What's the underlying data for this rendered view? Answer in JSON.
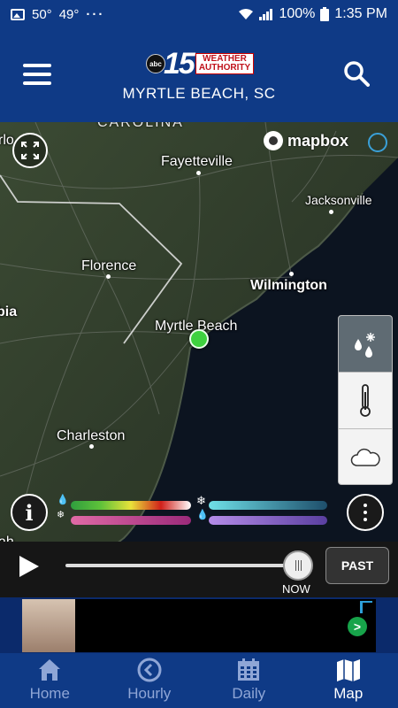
{
  "status_bar": {
    "temp_current": "50°",
    "temp_low": "49°",
    "dots": "···",
    "battery": "100%",
    "time": "1:35 PM"
  },
  "header": {
    "logo_network": "abc",
    "logo_number": "15",
    "logo_badge_line1": "WEATHER",
    "logo_badge_line2": "AUTHORITY",
    "location": "MYRTLE BEACH, SC"
  },
  "map": {
    "attribution": "mapbox",
    "state_label": "CAROLINA",
    "cities": {
      "fayetteville": "Fayetteville",
      "jacksonville": "Jacksonville",
      "florence": "Florence",
      "wilmington": "Wilmington",
      "myrtle_beach": "Myrtle Beach",
      "charleston": "Charleston",
      "partial_left_top": "rlo",
      "partial_left_mid": "bia",
      "partial_left_bottom": "ah"
    },
    "layers": [
      {
        "name": "precipitation",
        "icon": "rain-snow-icon",
        "active": true
      },
      {
        "name": "temperature",
        "icon": "thermometer-icon",
        "active": false
      },
      {
        "name": "clouds",
        "icon": "cloud-icon",
        "active": false
      }
    ],
    "legend": {
      "rain_colors": [
        "#3bb24a",
        "#e8e23a",
        "#d0201a",
        "#ffffff"
      ],
      "snow_colors": [
        "#6fe0e8",
        "#1e4e6b"
      ],
      "mix_colors": [
        "#e06aa6",
        "#9b2a7a"
      ],
      "ice_colors": [
        "#b58ce8",
        "#5a3fa0"
      ]
    }
  },
  "timeline": {
    "now_label": "NOW",
    "past_label": "PAST",
    "progress": 0.94
  },
  "ad": {
    "go_symbol": ">"
  },
  "bottom_nav": [
    {
      "label": "Home",
      "icon": "home-icon",
      "active": false
    },
    {
      "label": "Hourly",
      "icon": "clock-icon",
      "active": false
    },
    {
      "label": "Daily",
      "icon": "calendar-icon",
      "active": false
    },
    {
      "label": "Map",
      "icon": "map-icon",
      "active": true
    }
  ],
  "colors": {
    "brand_blue": "#0f3a86",
    "location_green": "#3fd13f"
  }
}
